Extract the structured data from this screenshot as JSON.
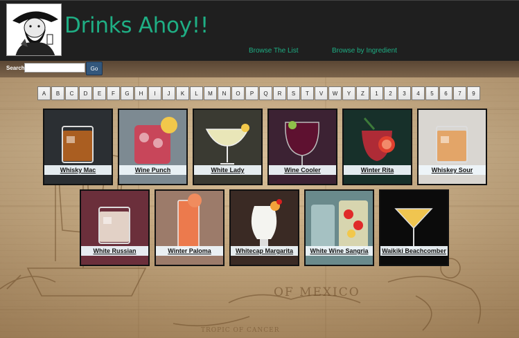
{
  "header": {
    "title": "Drinks Ahoy!!",
    "nav": {
      "browse_list": "Browse The List",
      "browse_ingredient": "Browse by Ingredient"
    }
  },
  "search": {
    "label": "Search:",
    "value": "",
    "go_label": "Go"
  },
  "alphabet": [
    "A",
    "B",
    "C",
    "D",
    "E",
    "F",
    "G",
    "H",
    "I",
    "J",
    "K",
    "L",
    "M",
    "N",
    "O",
    "P",
    "Q",
    "R",
    "S",
    "T",
    "V",
    "W",
    "Y",
    "Z",
    "1",
    "2",
    "3",
    "4",
    "5",
    "6",
    "7",
    "9"
  ],
  "drinks_row1": [
    {
      "name": "Whisky Mac",
      "icon": "rocks-glass-icon",
      "bg": "#2b2f33",
      "liquid": "#b8641f"
    },
    {
      "name": "Wine Punch",
      "icon": "punch-glass-icon",
      "bg": "#7d8a92",
      "liquid": "#c8465a"
    },
    {
      "name": "White Lady",
      "icon": "coupe-glass-icon",
      "bg": "#3a3a32",
      "liquid": "#e9e6b8"
    },
    {
      "name": "Wine Cooler",
      "icon": "wine-glass-icon",
      "bg": "#3c2233",
      "liquid": "#5e1130"
    },
    {
      "name": "Winter Rita",
      "icon": "margarita-glass-icon",
      "bg": "#17302a",
      "liquid": "#c92a38"
    },
    {
      "name": "Whiskey Sour",
      "icon": "rocks-glass-icon",
      "bg": "#d9d6d1",
      "liquid": "#e3a05c"
    }
  ],
  "drinks_row2": [
    {
      "name": "White Russian",
      "icon": "rocks-glass-icon",
      "bg": "#6b2f3b",
      "liquid": "#efe3d6"
    },
    {
      "name": "Winter Paloma",
      "icon": "highball-glass-icon",
      "bg": "#9c7b6a",
      "liquid": "#ec7a4d"
    },
    {
      "name": "Whitecap Margarita",
      "icon": "hurricane-glass-icon",
      "bg": "#3a2a24",
      "liquid": "#f4f4f0"
    },
    {
      "name": "White Wine Sangria",
      "icon": "pitcher-glass-icon",
      "bg": "#6a8a8c",
      "liquid": "#f2e7b8"
    },
    {
      "name": "Waikiki Beachcomber",
      "icon": "martini-glass-icon",
      "bg": "#0b0b0b",
      "liquid": "#f0c550"
    }
  ]
}
